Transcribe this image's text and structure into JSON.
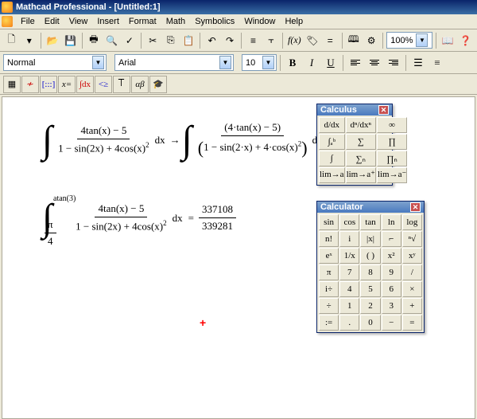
{
  "title": "Mathcad Professional - [Untitled:1]",
  "menu": [
    "File",
    "Edit",
    "View",
    "Insert",
    "Format",
    "Math",
    "Symbolics",
    "Window",
    "Help"
  ],
  "toolbar1": {
    "zoom": "100%",
    "fx": "f(x)"
  },
  "toolbar2": {
    "style": "Normal",
    "font": "Arial",
    "size": "10",
    "bold": "B",
    "italic": "I",
    "underline": "U"
  },
  "palettebar": {
    "items": [
      "▦",
      "≁",
      "[:::]",
      "x=",
      "∫dx",
      "<≥",
      "𐊗",
      "αβ",
      "🎓"
    ]
  },
  "math1": {
    "int_left_num": "4tan(x) − 5",
    "int_left_den": "1 − sin(2x) + 4cos(x)",
    "dx": "dx",
    "arrow": "→",
    "int_right_num": "(4·tan(x) − 5)",
    "int_right_den_open": "(",
    "int_right_den_body": "1 − sin(2·x) + 4·cos(x)",
    "int_right_den_close": ")",
    "sq": "2"
  },
  "math2": {
    "upper": "atan(3)",
    "lower_num": "π",
    "lower_den": "4",
    "num": "4tan(x) − 5",
    "den": "1 − sin(2x) + 4cos(x)",
    "dx": "dx",
    "eq": "=",
    "res_num": "337108",
    "res_den": "339281",
    "sq": "2"
  },
  "palette_calc": {
    "title": "Calculus",
    "cells": [
      "d/dx",
      "dⁿ/dxⁿ",
      "∞",
      "∫ₐᵇ",
      "∑",
      "∏",
      "∫",
      "∑ₙ",
      "∏ₙ",
      "lim→a",
      "lim→a⁺",
      "lim→a⁻"
    ]
  },
  "palette_calculator": {
    "title": "Calculator",
    "cells": [
      "sin",
      "cos",
      "tan",
      "ln",
      "log",
      "n!",
      "i",
      "|x|",
      "⌐",
      "ⁿ√",
      "eˣ",
      "1/x",
      "( )",
      "x²",
      "xʸ",
      "π",
      "7",
      "8",
      "9",
      "/",
      "i÷",
      "4",
      "5",
      "6",
      "×",
      "÷",
      "1",
      "2",
      "3",
      "+",
      ":=",
      ".",
      "0",
      "−",
      "="
    ]
  }
}
